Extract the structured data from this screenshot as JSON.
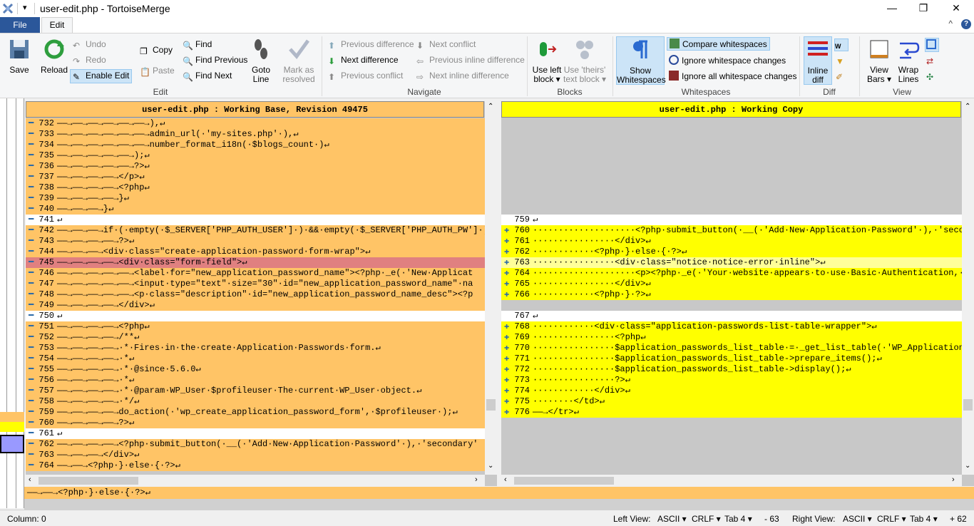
{
  "titlebar": {
    "title": "user-edit.php - TortoiseMerge",
    "qat": "▾",
    "min": "—",
    "max": "❐",
    "close": "✕"
  },
  "tabs": {
    "file": "File",
    "edit": "Edit",
    "help": "?",
    "collapse": "^"
  },
  "ribbon": {
    "save": "Save",
    "reload": "Reload",
    "undo": "Undo",
    "redo": "Redo",
    "enable_edit": "Enable Edit",
    "copy": "Copy",
    "paste": "Paste",
    "find": "Find",
    "find_previous": "Find Previous",
    "find_next": "Find Next",
    "goto_line": [
      "Goto",
      "Line"
    ],
    "mark_resolved": [
      "Mark as",
      "resolved"
    ],
    "group_edit": "Edit",
    "prev_diff": "Previous difference",
    "next_diff": "Next difference",
    "prev_conflict": "Previous conflict",
    "next_conflict": "Next conflict",
    "prev_inline": "Previous inline difference",
    "next_inline": "Next inline difference",
    "group_navigate": "Navigate",
    "use_left": [
      "Use left",
      "block ▾"
    ],
    "use_theirs": [
      "Use 'theirs'",
      "text block ▾"
    ],
    "group_blocks": "Blocks",
    "show_ws": [
      "Show",
      "Whitespaces"
    ],
    "compare_ws": "Compare whitespaces",
    "ignore_ws_changes": "Ignore whitespace changes",
    "ignore_all_ws": "Ignore all whitespace changes",
    "group_whitespaces": "Whitespaces",
    "inline_diff": [
      "Inline",
      "diff"
    ],
    "group_diff": "Diff",
    "view_bars": [
      "View",
      "Bars ▾"
    ],
    "wrap_lines": [
      "Wrap",
      "Lines"
    ],
    "group_view": "View"
  },
  "left_pane": {
    "header": "user-edit.php : Working Base, Revision 49475",
    "lines": [
      {
        "n": "732",
        "m": "━",
        "t": "——→——→——→——→——→——→),↵",
        "c": "#ffc466"
      },
      {
        "n": "733",
        "m": "━",
        "t": "——→——→——→——→——→——→admin_url(·'my-sites.php'·),↵",
        "c": "#ffc466"
      },
      {
        "n": "734",
        "m": "━",
        "t": "——→——→——→——→——→——→number_format_i18n(·$blogs_count·)↵",
        "c": "#ffc466"
      },
      {
        "n": "735",
        "m": "━",
        "t": "——→——→——→——→——→);↵",
        "c": "#ffc466"
      },
      {
        "n": "736",
        "m": "━",
        "t": "——→——→——→——→——→?>↵",
        "c": "#ffc466"
      },
      {
        "n": "737",
        "m": "━",
        "t": "——→——→——→——→</p>↵",
        "c": "#ffc466"
      },
      {
        "n": "738",
        "m": "━",
        "t": "——→——→——→——→<?php↵",
        "c": "#ffc466"
      },
      {
        "n": "739",
        "m": "━",
        "t": "——→——→——→——→}↵",
        "c": "#ffc466"
      },
      {
        "n": "740",
        "m": "━",
        "t": "——→——→——→}↵",
        "c": "#ffc466"
      },
      {
        "n": "741",
        "m": "━",
        "t": "↵",
        "c": "#ffffff"
      },
      {
        "n": "742",
        "m": "━",
        "t": "——→——→——→if·(·empty(·$_SERVER['PHP_AUTH_USER']·)·&&·empty(·$_SERVER['PHP_AUTH_PW']·)",
        "c": "#ffc466"
      },
      {
        "n": "743",
        "m": "━",
        "t": "——→——→——→——→?>↵",
        "c": "#ffc466"
      },
      {
        "n": "744",
        "m": "━",
        "t": "——→——→——→<div·class=\"create-application-password·form-wrap\">↵",
        "c": "#ffc466"
      },
      {
        "n": "745",
        "m": "━",
        "t": "——→——→——→——→<div·class=\"form-field\">↵",
        "c": "#e08080"
      },
      {
        "n": "746",
        "m": "━",
        "t": "——→——→——→——→——→<label·for=\"new_application_password_name\"><?php·_e(·'New·Applicat",
        "c": "#ffc466"
      },
      {
        "n": "747",
        "m": "━",
        "t": "——→——→——→——→——→<input·type=\"text\"·size=\"30\"·id=\"new_application_password_name\"·na",
        "c": "#ffc466"
      },
      {
        "n": "748",
        "m": "━",
        "t": "——→——→——→——→——→<p·class=\"description\"·id=\"new_application_password_name_desc\"><?p",
        "c": "#ffc466"
      },
      {
        "n": "749",
        "m": "━",
        "t": "——→——→——→——→</div>↵",
        "c": "#ffc466"
      },
      {
        "n": "750",
        "m": "━",
        "t": "↵",
        "c": "#ffffff"
      },
      {
        "n": "751",
        "m": "━",
        "t": "——→——→——→——→<?php↵",
        "c": "#ffc466"
      },
      {
        "n": "752",
        "m": "━",
        "t": "——→——→——→——→/**↵",
        "c": "#ffc466"
      },
      {
        "n": "753",
        "m": "━",
        "t": "——→——→——→——→·*·Fires·in·the·create·Application·Passwords·form.↵",
        "c": "#ffc466"
      },
      {
        "n": "754",
        "m": "━",
        "t": "——→——→——→——→·*↵",
        "c": "#ffc466"
      },
      {
        "n": "755",
        "m": "━",
        "t": "——→——→——→——→·*·@since·5.6.0↵",
        "c": "#ffc466"
      },
      {
        "n": "756",
        "m": "━",
        "t": "——→——→——→——→·*↵",
        "c": "#ffc466"
      },
      {
        "n": "757",
        "m": "━",
        "t": "——→——→——→——→·*·@param·WP_User·$profileuser·The·current·WP_User·object.↵",
        "c": "#ffc466"
      },
      {
        "n": "758",
        "m": "━",
        "t": "——→——→——→——→·*/↵",
        "c": "#ffc466"
      },
      {
        "n": "759",
        "m": "━",
        "t": "——→——→——→——→do_action(·'wp_create_application_password_form',·$profileuser·);↵",
        "c": "#ffc466"
      },
      {
        "n": "760",
        "m": "━",
        "t": "——→——→——→——→?>↵",
        "c": "#ffc466"
      },
      {
        "n": "761",
        "m": "━",
        "t": "↵",
        "c": "#ffffff"
      },
      {
        "n": "762",
        "m": "━",
        "t": "——→——→——→——→<?php·submit_button(·__(·'Add·New·Application·Password'·),·'secondary'",
        "c": "#ffc466"
      },
      {
        "n": "763",
        "m": "━",
        "t": "——→——→——→</div>↵",
        "c": "#ffc466"
      },
      {
        "n": "764",
        "m": "━",
        "t": "——→——→<?php·}·else·{·?>↵",
        "c": "#ffc466"
      }
    ]
  },
  "right_pane": {
    "header": "user-edit.php : Working Copy",
    "lines": [
      {
        "n": "",
        "m": "",
        "t": "",
        "c": "#c8c8c8"
      },
      {
        "n": "",
        "m": "",
        "t": "",
        "c": "#c8c8c8"
      },
      {
        "n": "",
        "m": "",
        "t": "",
        "c": "#c8c8c8"
      },
      {
        "n": "",
        "m": "",
        "t": "",
        "c": "#c8c8c8"
      },
      {
        "n": "",
        "m": "",
        "t": "",
        "c": "#c8c8c8"
      },
      {
        "n": "",
        "m": "",
        "t": "",
        "c": "#c8c8c8"
      },
      {
        "n": "",
        "m": "",
        "t": "",
        "c": "#c8c8c8"
      },
      {
        "n": "",
        "m": "",
        "t": "",
        "c": "#c8c8c8"
      },
      {
        "n": "",
        "m": "",
        "t": "",
        "c": "#c8c8c8"
      },
      {
        "n": "759",
        "m": "",
        "t": "↵",
        "c": "#ffffff"
      },
      {
        "n": "760",
        "m": "✚",
        "t": "····················<?php·submit_button(·__(·'Add·New·Application·Password'·),·'second",
        "c": "#ffff00"
      },
      {
        "n": "761",
        "m": "✚",
        "t": "················</div>↵",
        "c": "#ffff00"
      },
      {
        "n": "762",
        "m": "✚",
        "t": "············<?php·}·else·{·?>↵",
        "c": "#ffff00"
      },
      {
        "n": "763",
        "m": "✚",
        "t": "················<div·class=\"notice·notice-error·inline\">↵",
        "c": "#ffff99"
      },
      {
        "n": "764",
        "m": "✚",
        "t": "····················<p><?php·_e(·'Your·website·appears·to·use·Basic·Authentication,·wh",
        "c": "#ffff00"
      },
      {
        "n": "765",
        "m": "✚",
        "t": "················</div>↵",
        "c": "#ffff00"
      },
      {
        "n": "766",
        "m": "✚",
        "t": "············<?php·}·?>↵",
        "c": "#ffff00"
      },
      {
        "n": "",
        "m": "",
        "t": "",
        "c": "#c8c8c8"
      },
      {
        "n": "767",
        "m": "",
        "t": "↵",
        "c": "#ffffff"
      },
      {
        "n": "768",
        "m": "✚",
        "t": "············<div·class=\"application-passwords-list-table-wrapper\">↵",
        "c": "#ffff00"
      },
      {
        "n": "769",
        "m": "✚",
        "t": "················<?php↵",
        "c": "#ffff00"
      },
      {
        "n": "770",
        "m": "✚",
        "t": "················$application_passwords_list_table·=·_get_list_table(·'WP_Application_P",
        "c": "#ffff00"
      },
      {
        "n": "771",
        "m": "✚",
        "t": "················$application_passwords_list_table->prepare_items();↵",
        "c": "#ffff00"
      },
      {
        "n": "772",
        "m": "✚",
        "t": "················$application_passwords_list_table->display();↵",
        "c": "#ffff00"
      },
      {
        "n": "773",
        "m": "✚",
        "t": "················?>↵",
        "c": "#ffff00"
      },
      {
        "n": "774",
        "m": "✚",
        "t": "············</div>↵",
        "c": "#ffff00"
      },
      {
        "n": "775",
        "m": "✚",
        "t": "········</td>↵",
        "c": "#ffff00"
      },
      {
        "n": "776",
        "m": "✚",
        "t": "——→</tr>↵",
        "c": "#ffff00"
      }
    ]
  },
  "bottom_line": "——→——→<?php·}·else·{·?>↵",
  "status": {
    "column": "Column: 0",
    "left_view": "Left View:",
    "left_enc": "ASCII ▾",
    "left_eol": "CRLF ▾",
    "left_tab": "Tab 4 ▾",
    "left_count": "- 63",
    "right_view": "Right View:",
    "right_enc": "ASCII ▾",
    "right_eol": "CRLF ▾",
    "right_tab": "Tab 4 ▾",
    "right_count": "+ 62"
  },
  "colors": {
    "changed": "#ffc466",
    "added": "#ffff00",
    "file_tab": "#2b579a"
  }
}
